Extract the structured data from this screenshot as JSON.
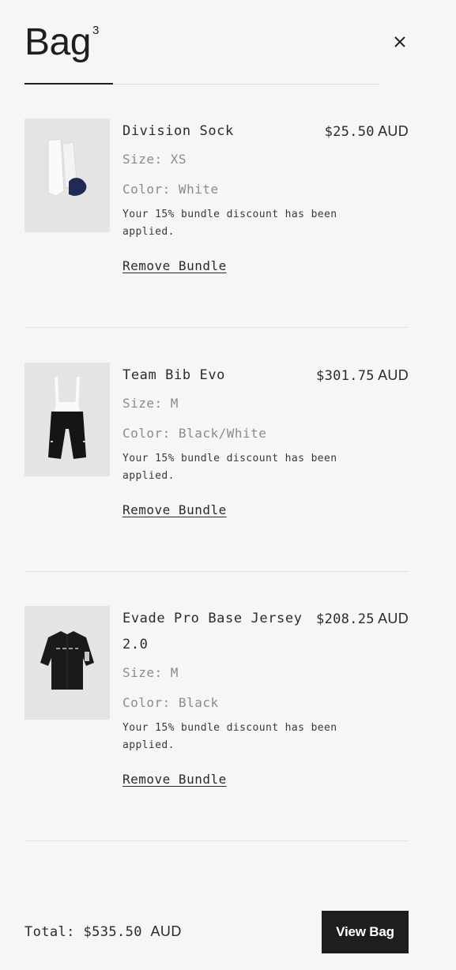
{
  "header": {
    "title": "Bag",
    "count": "3"
  },
  "items": [
    {
      "name": "Division Sock",
      "price": "$25.50",
      "currency": "AUD",
      "size": "Size: XS",
      "color": "Color: White",
      "discount": "Your 15% bundle discount has been applied.",
      "remove_label": "Remove Bundle"
    },
    {
      "name": "Team Bib Evo",
      "price": "$301.75",
      "currency": "AUD",
      "size": "Size: M",
      "color": "Color: Black/White",
      "discount": "Your 15% bundle discount has been applied.",
      "remove_label": "Remove Bundle"
    },
    {
      "name": "Evade Pro Base Jersey 2.0",
      "price": "$208.25",
      "currency": "AUD",
      "size": "Size: M",
      "color": "Color: Black",
      "discount": "Your 15% bundle discount has been applied.",
      "remove_label": "Remove Bundle"
    }
  ],
  "footer": {
    "total_label": "Total: $535.50",
    "total_currency": "AUD",
    "view_bag_label": "View Bag"
  },
  "colors": {
    "background": "#f6f6f6",
    "button": "#1e1e1e",
    "muted_text": "#8b8b8b"
  }
}
